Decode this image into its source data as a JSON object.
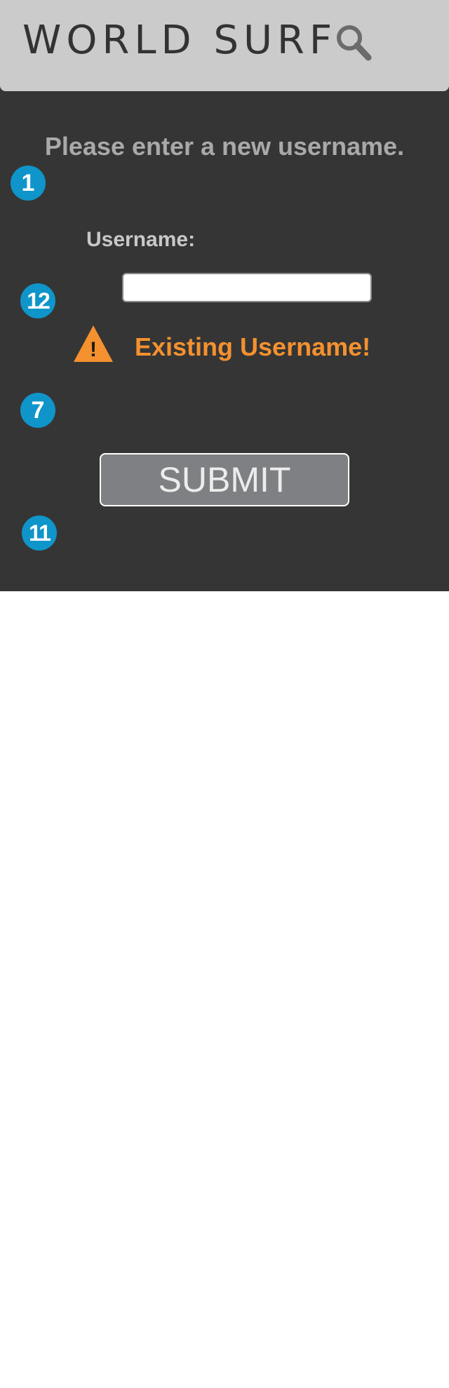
{
  "header": {
    "brand": "WORLD SURF",
    "search_icon": "search-icon"
  },
  "form": {
    "prompt": "Please enter a new username.",
    "username_label": "Username:",
    "username_value": "",
    "warning_icon": "warning-triangle-icon",
    "warning_glyph": "!",
    "warning_text": "Existing Username!",
    "submit_label": "SUBMIT"
  },
  "annotations": [
    "1",
    "12",
    "7",
    "11"
  ],
  "colors": {
    "background": "#353535",
    "header": "#cbcbcb",
    "badge": "#0f95c9",
    "warning": "#f5912f",
    "button": "#7f8083"
  }
}
